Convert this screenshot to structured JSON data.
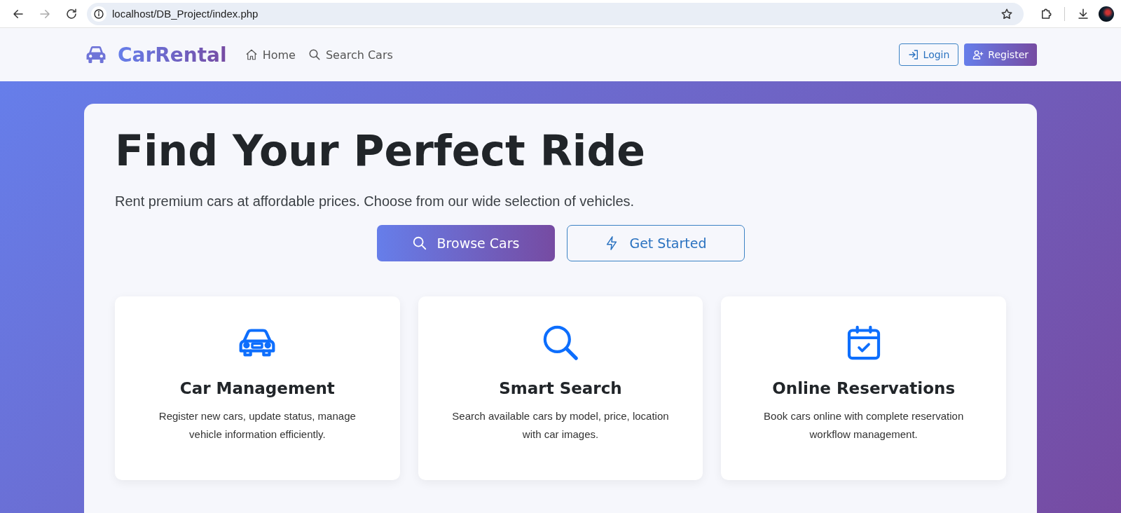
{
  "browser": {
    "url": "localhost/DB_Project/index.php"
  },
  "navbar": {
    "brand": "CarRental",
    "links": [
      {
        "label": "Home"
      },
      {
        "label": "Search Cars"
      }
    ],
    "buttons": [
      {
        "label": "Login",
        "kind": "outline"
      },
      {
        "label": "Register",
        "kind": "filled"
      }
    ]
  },
  "hero": {
    "title": "Find Your Perfect Ride",
    "subtitle": "Rent premium cars at affordable prices. Choose from our wide selection of vehicles.",
    "buttons": [
      {
        "label": "Browse Cars",
        "kind": "filled"
      },
      {
        "label": "Get Started",
        "kind": "outline"
      }
    ]
  },
  "features": [
    {
      "title": "Car Management",
      "text": "Register new cars, update status, manage vehicle information efficiently."
    },
    {
      "title": "Smart Search",
      "text": "Search available cars by model, price, location with car images."
    },
    {
      "title": "Online Reservations",
      "text": "Book cars online with complete reservation workflow management."
    }
  ]
}
